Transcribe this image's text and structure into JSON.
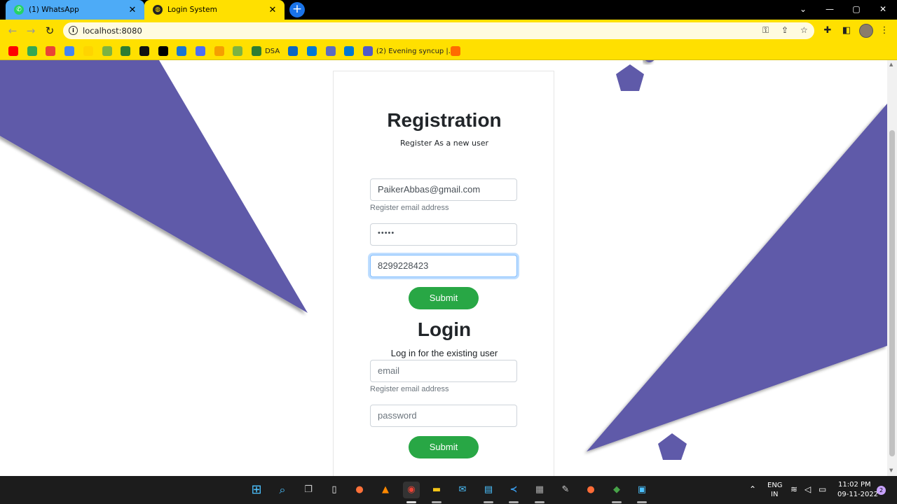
{
  "browser": {
    "tabs": [
      {
        "title": "(1) WhatsApp",
        "close": "✕"
      },
      {
        "title": "Login System",
        "close": "✕"
      }
    ],
    "new_tab": "+",
    "window_controls": {
      "minimize": "—",
      "maximize": "▢",
      "close": "✕",
      "tabsearch": "⌄"
    },
    "url": "localhost:8080",
    "bookmarks": [
      {
        "label": "",
        "color": "#ff0000"
      },
      {
        "label": "",
        "color": "#34a853"
      },
      {
        "label": "",
        "color": "#ea4335"
      },
      {
        "label": "",
        "color": "#4285f4"
      },
      {
        "label": "",
        "color": "#ffd400"
      },
      {
        "label": "",
        "color": "#7cb342"
      },
      {
        "label": "",
        "color": "#2e7d32"
      },
      {
        "label": "",
        "color": "#111111"
      },
      {
        "label": "",
        "color": "#000000"
      },
      {
        "label": "",
        "color": "#1976d2"
      },
      {
        "label": "",
        "color": "#4c6ef5"
      },
      {
        "label": "",
        "color": "#f59f00"
      },
      {
        "label": "",
        "color": "#7cb342"
      },
      {
        "label": "DSA",
        "color": "#2e7d32"
      },
      {
        "label": "",
        "color": "#0a66c2"
      },
      {
        "label": "",
        "color": "#0078d4"
      },
      {
        "label": "",
        "color": "#5c6bc0"
      },
      {
        "label": "",
        "color": "#0078d4"
      },
      {
        "label": "(2) Evening syncup |...",
        "color": "#5059c9"
      },
      {
        "label": "",
        "color": "#ff6b00"
      }
    ]
  },
  "registration": {
    "title": "Registration",
    "subtitle": "Register As a new user",
    "email_value": "PaikerAbbas@gmail.com",
    "email_help": "Register email address",
    "password_value": "•••••",
    "phone_value": "8299228423",
    "submit_label": "Submit"
  },
  "login": {
    "title": "Login",
    "subtitle": "Log in for the existing user",
    "email_placeholder": "email",
    "email_help": "Register email address",
    "password_placeholder": "password",
    "submit_label": "Submit"
  },
  "taskbar": {
    "language": "ENG",
    "region": "IN",
    "time": "11:02 PM",
    "date": "09-11-2022",
    "notifications": "2"
  },
  "colors": {
    "browser_accent": "#ffe000",
    "shape_purple": "#5f5aa9",
    "button_green": "#28a745"
  }
}
